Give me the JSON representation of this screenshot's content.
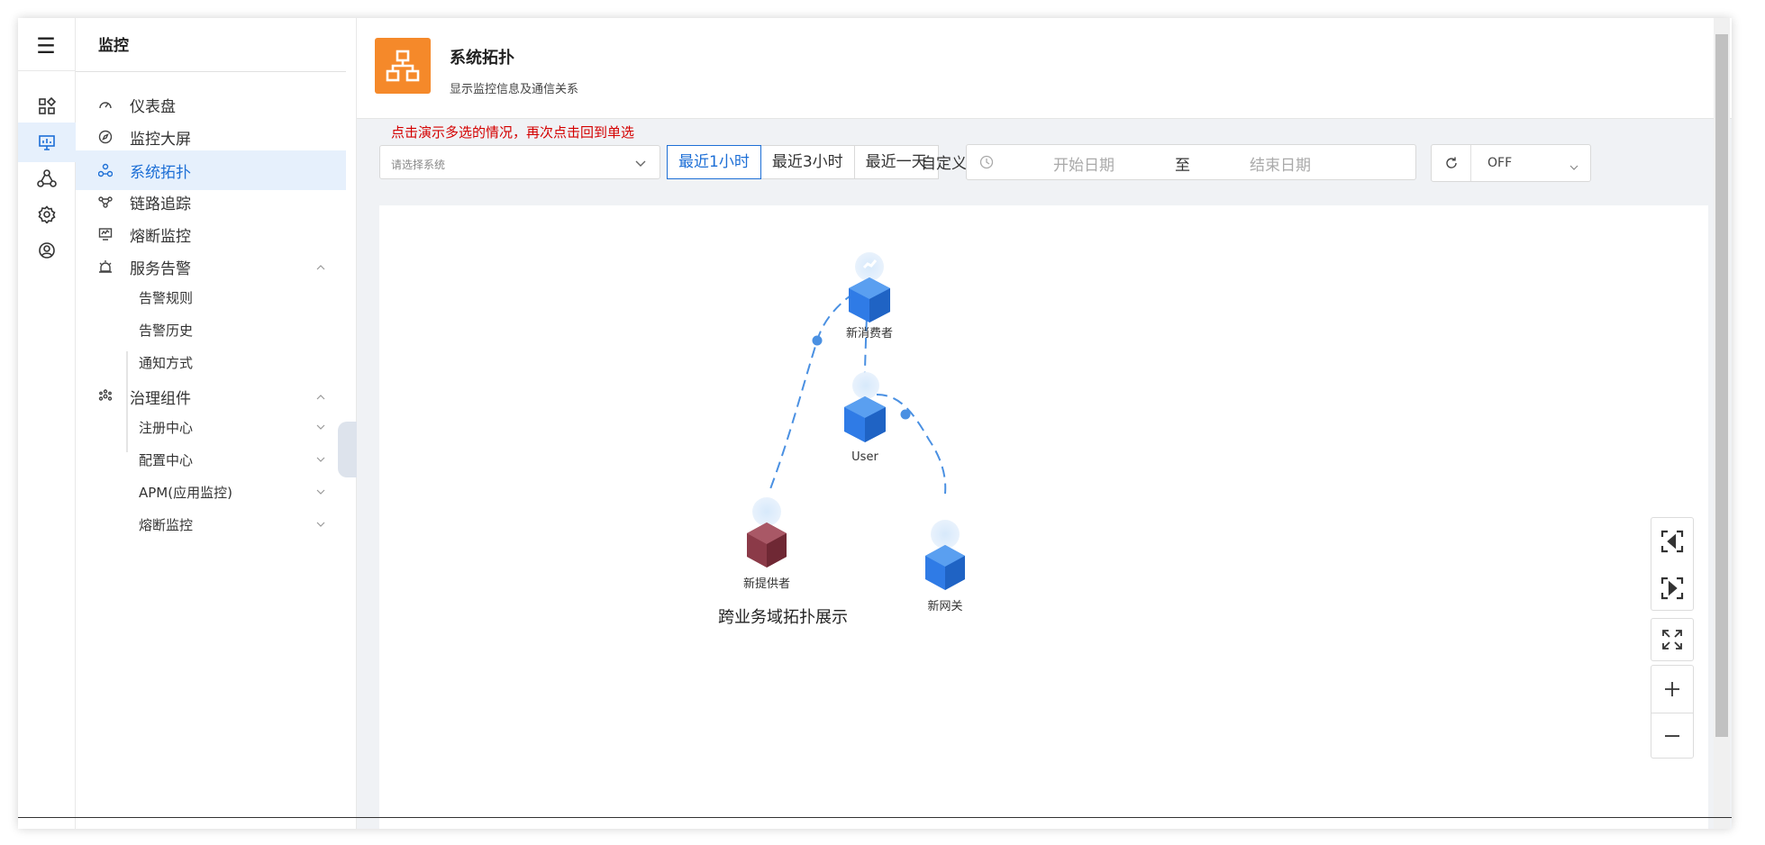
{
  "menu": {
    "title": "监控",
    "items": [
      {
        "label": "仪表盘"
      },
      {
        "label": "监控大屏"
      },
      {
        "label": "系统拓扑"
      },
      {
        "label": "链路追踪"
      },
      {
        "label": "熔断监控"
      },
      {
        "label": "服务告警"
      },
      {
        "label": "治理组件"
      }
    ],
    "alarm_sub": [
      "告警规则",
      "告警历史",
      "通知方式"
    ],
    "gov_sub": [
      "注册中心",
      "配置中心",
      "APM(应用监控)",
      "熔断监控"
    ]
  },
  "header": {
    "title": "系统拓扑",
    "desc": "显示监控信息及通信关系"
  },
  "toolbar": {
    "hint": "点击演示多选的情况，再次点击回到单选",
    "select_placeholder": "请选择系统",
    "ranges": [
      "最近1小时",
      "最近3小时",
      "最近一天"
    ],
    "custom_label": "自定义:",
    "start_placeholder": "开始日期",
    "to": "至",
    "end_placeholder": "结束日期",
    "refresh_value": "OFF"
  },
  "topology": {
    "title": "跨业务域拓扑展示",
    "nodes": [
      {
        "label": "新消费者",
        "color": "#2f7be6"
      },
      {
        "label": "User",
        "color": "#2f7be6"
      },
      {
        "label": "新提供者",
        "color": "#8b3a48"
      },
      {
        "label": "新网关",
        "color": "#2f7be6"
      }
    ]
  },
  "colors": {
    "accent": "#1d6fd6",
    "brand": "#f5892a",
    "hint": "#d40000"
  }
}
